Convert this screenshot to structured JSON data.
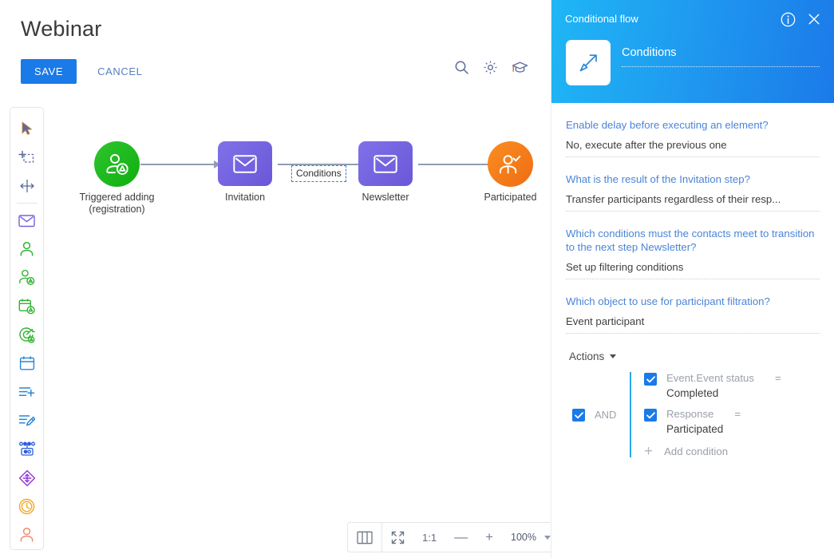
{
  "page": {
    "title": "Webinar"
  },
  "action_bar": {
    "save_label": "SAVE",
    "cancel_label": "CANCEL"
  },
  "canvas_tools": [
    {
      "name": "search-icon",
      "title": "Search"
    },
    {
      "name": "gear-icon",
      "title": "Settings"
    },
    {
      "name": "graduation-cap-icon",
      "title": "Training"
    }
  ],
  "toolbox": {
    "items": [
      {
        "name": "cursor-tool",
        "title": "Select"
      },
      {
        "name": "select-area-tool",
        "title": "Select area"
      },
      {
        "name": "move-tool",
        "title": "Move"
      },
      {
        "name": "email-element",
        "title": "Email"
      },
      {
        "name": "person-element",
        "title": "Contact"
      },
      {
        "name": "add-participant-element",
        "title": "Add participant"
      },
      {
        "name": "schedule-element",
        "title": "Schedule"
      },
      {
        "name": "goal-element",
        "title": "Goal"
      },
      {
        "name": "calendar-element",
        "title": "Calendar"
      },
      {
        "name": "add-record-element",
        "title": "Add record"
      },
      {
        "name": "edit-record-element",
        "title": "Edit record"
      },
      {
        "name": "split-flow-element",
        "title": "Split flow"
      },
      {
        "name": "conditional-flow-element",
        "title": "Conditional flow"
      },
      {
        "name": "timer-element",
        "title": "Timer"
      },
      {
        "name": "exit-element",
        "title": "Exit"
      }
    ]
  },
  "flow": {
    "nodes": [
      {
        "id": "start",
        "label": "Triggered adding\n(registration)",
        "shape": "circle",
        "icon": "person-add-icon"
      },
      {
        "id": "invitation",
        "label": "Invitation",
        "shape": "square",
        "icon": "envelope-icon"
      },
      {
        "id": "newsletter",
        "label": "Newsletter",
        "shape": "square",
        "icon": "envelope-icon"
      },
      {
        "id": "end",
        "label": "Participated",
        "shape": "circle",
        "icon": "person-check-icon"
      }
    ],
    "conditions_chip": "Conditions"
  },
  "zoom_bar": {
    "columns_label": "columns-icon",
    "fit_label": "fit-to-screen-icon",
    "ratio_label": "1:1",
    "minus_label": "—",
    "plus_label": "+",
    "zoom_level": "100%"
  },
  "panel": {
    "header_title": "Conditional flow",
    "type_icon": "conditional-arrow-icon",
    "name_value": "Conditions",
    "info_icon": "info-icon",
    "close_icon": "close-icon",
    "fields": [
      {
        "label": "Enable delay before executing an element?",
        "value": "No, execute after the previous one"
      },
      {
        "label": "What is the result of the Invitation step?",
        "value": "Transfer participants regardless of their resp..."
      },
      {
        "label": "Which conditions must the contacts meet to transition to the next step Newsletter?",
        "value": "Set up filtering conditions"
      },
      {
        "label": "Which object to use for participant filtration?",
        "value": "Event participant"
      }
    ],
    "actions": {
      "toggle_label": "Actions",
      "logic_operator": "AND",
      "conditions": [
        {
          "attribute": "Event.Event status",
          "operator": "=",
          "value": "Completed",
          "checked": true
        },
        {
          "attribute": "Response",
          "operator": "=",
          "value": "Participated",
          "checked": true
        }
      ],
      "add_condition_label": "Add condition"
    }
  },
  "colors": {
    "accent_blue": "#1a7ae8",
    "link_blue": "#4b85d8",
    "panel_gradient_start": "#1fb6f6",
    "panel_gradient_end": "#1b7ae9",
    "node_start_green": "#22b522",
    "node_email_purple": "#7263e0",
    "node_end_orange": "#f57c20",
    "condition_rail": "#2aa8e8"
  }
}
